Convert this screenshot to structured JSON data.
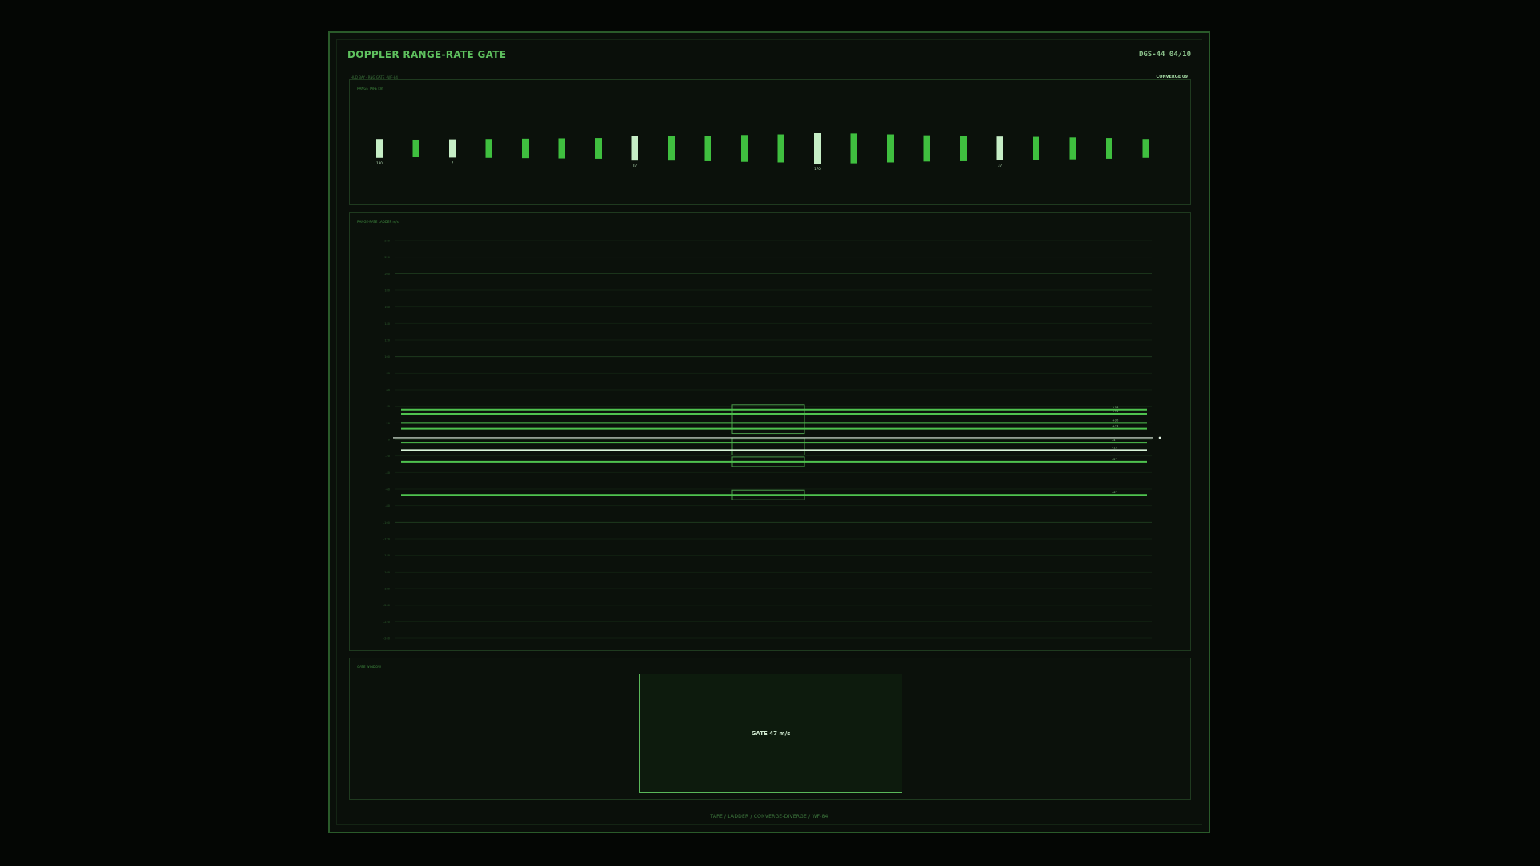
{
  "header": {
    "title": "DOPPLER RANGE-RATE GATE",
    "device_id": "DGS-44 04/10",
    "meta_left": "HUD BAY · RNG GATE · WF-84",
    "status": "CONVERGE 09"
  },
  "range_tape": {
    "label": "RANGE TAPE km",
    "bars": [
      {
        "level": 0.62,
        "highlight": true,
        "label": "130"
      },
      {
        "level": 0.58,
        "highlight": false,
        "label": ""
      },
      {
        "level": 0.6,
        "highlight": true,
        "label": "2"
      },
      {
        "level": 0.62,
        "highlight": false,
        "label": ""
      },
      {
        "level": 0.64,
        "highlight": false,
        "label": ""
      },
      {
        "level": 0.66,
        "highlight": false,
        "label": ""
      },
      {
        "level": 0.68,
        "highlight": false,
        "label": ""
      },
      {
        "level": 0.8,
        "highlight": true,
        "label": "87"
      },
      {
        "level": 0.8,
        "highlight": false,
        "label": ""
      },
      {
        "level": 0.84,
        "highlight": false,
        "label": ""
      },
      {
        "level": 0.88,
        "highlight": false,
        "label": ""
      },
      {
        "level": 0.92,
        "highlight": false,
        "label": ""
      },
      {
        "level": 1.0,
        "highlight": true,
        "label": "170"
      },
      {
        "level": 0.98,
        "highlight": false,
        "label": ""
      },
      {
        "level": 0.92,
        "highlight": false,
        "label": ""
      },
      {
        "level": 0.86,
        "highlight": false,
        "label": ""
      },
      {
        "level": 0.84,
        "highlight": false,
        "label": ""
      },
      {
        "level": 0.78,
        "highlight": true,
        "label": "37"
      },
      {
        "level": 0.76,
        "highlight": false,
        "label": ""
      },
      {
        "level": 0.72,
        "highlight": false,
        "label": ""
      },
      {
        "level": 0.68,
        "highlight": false,
        "label": ""
      },
      {
        "level": 0.62,
        "highlight": false,
        "label": ""
      }
    ]
  },
  "ladder": {
    "label": "RANGE-RATE LADDER m/s",
    "ylim": [
      -240,
      240
    ],
    "tick_step": 20,
    "major_every": 100,
    "lines": [
      {
        "value": 36,
        "label": "+36",
        "bright": false
      },
      {
        "value": 31,
        "label": "+31",
        "bright": false
      },
      {
        "value": 20,
        "label": "+20",
        "bright": false
      },
      {
        "value": 13,
        "label": "+13",
        "bright": false
      },
      {
        "value": -4,
        "label": "-4",
        "bright": false
      },
      {
        "value": -13,
        "label": "-13",
        "bright": true
      },
      {
        "value": -27,
        "label": "-27",
        "bright": false
      },
      {
        "value": -67,
        "label": "-67",
        "bright": false
      }
    ],
    "reference": {
      "value": 2
    }
  },
  "gate": {
    "label": "GATE WINDOW",
    "text": "GATE 47 m/s"
  },
  "footer": "TAPE / LADDER / CONVERGE-DIVERGE / WF-84",
  "colors": {
    "accent": "#5ec05e",
    "bar": "#3fbf3f",
    "bar_highlight": "#c6eec6",
    "line": "#4fc24f",
    "line_bright": "#d8f4d8"
  }
}
